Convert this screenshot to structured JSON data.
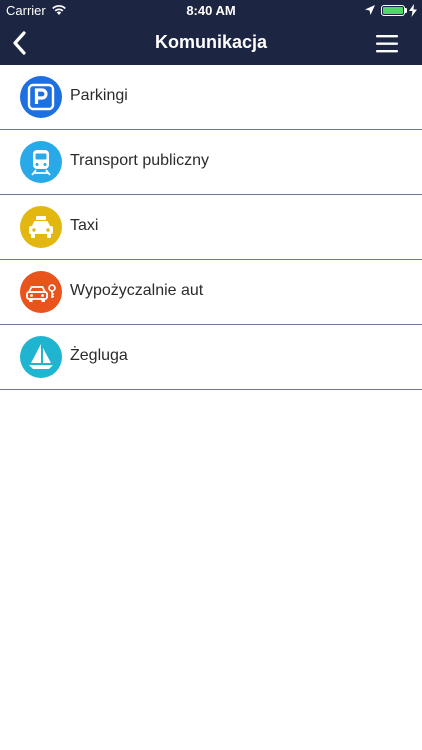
{
  "status_bar": {
    "carrier": "Carrier",
    "time": "8:40 AM",
    "battery_color": "#4cd964"
  },
  "nav": {
    "title": "Komunikacja",
    "background": "#1c2541",
    "back_icon": "chevron-left-icon",
    "menu_icon": "hamburger-menu-icon"
  },
  "items": [
    {
      "label": "Parkingi",
      "icon": "parking-icon",
      "color": "#1e6fe0"
    },
    {
      "label": "Transport publiczny",
      "icon": "train-icon",
      "color": "#29a9e8"
    },
    {
      "label": "Taxi",
      "icon": "taxi-icon",
      "color": "#e2b70f"
    },
    {
      "label": "Wypożyczalnie aut",
      "icon": "car-rental-icon",
      "color": "#e8541c"
    },
    {
      "label": "Żegluga",
      "icon": "sailboat-icon",
      "color": "#1fb5d0"
    }
  ]
}
